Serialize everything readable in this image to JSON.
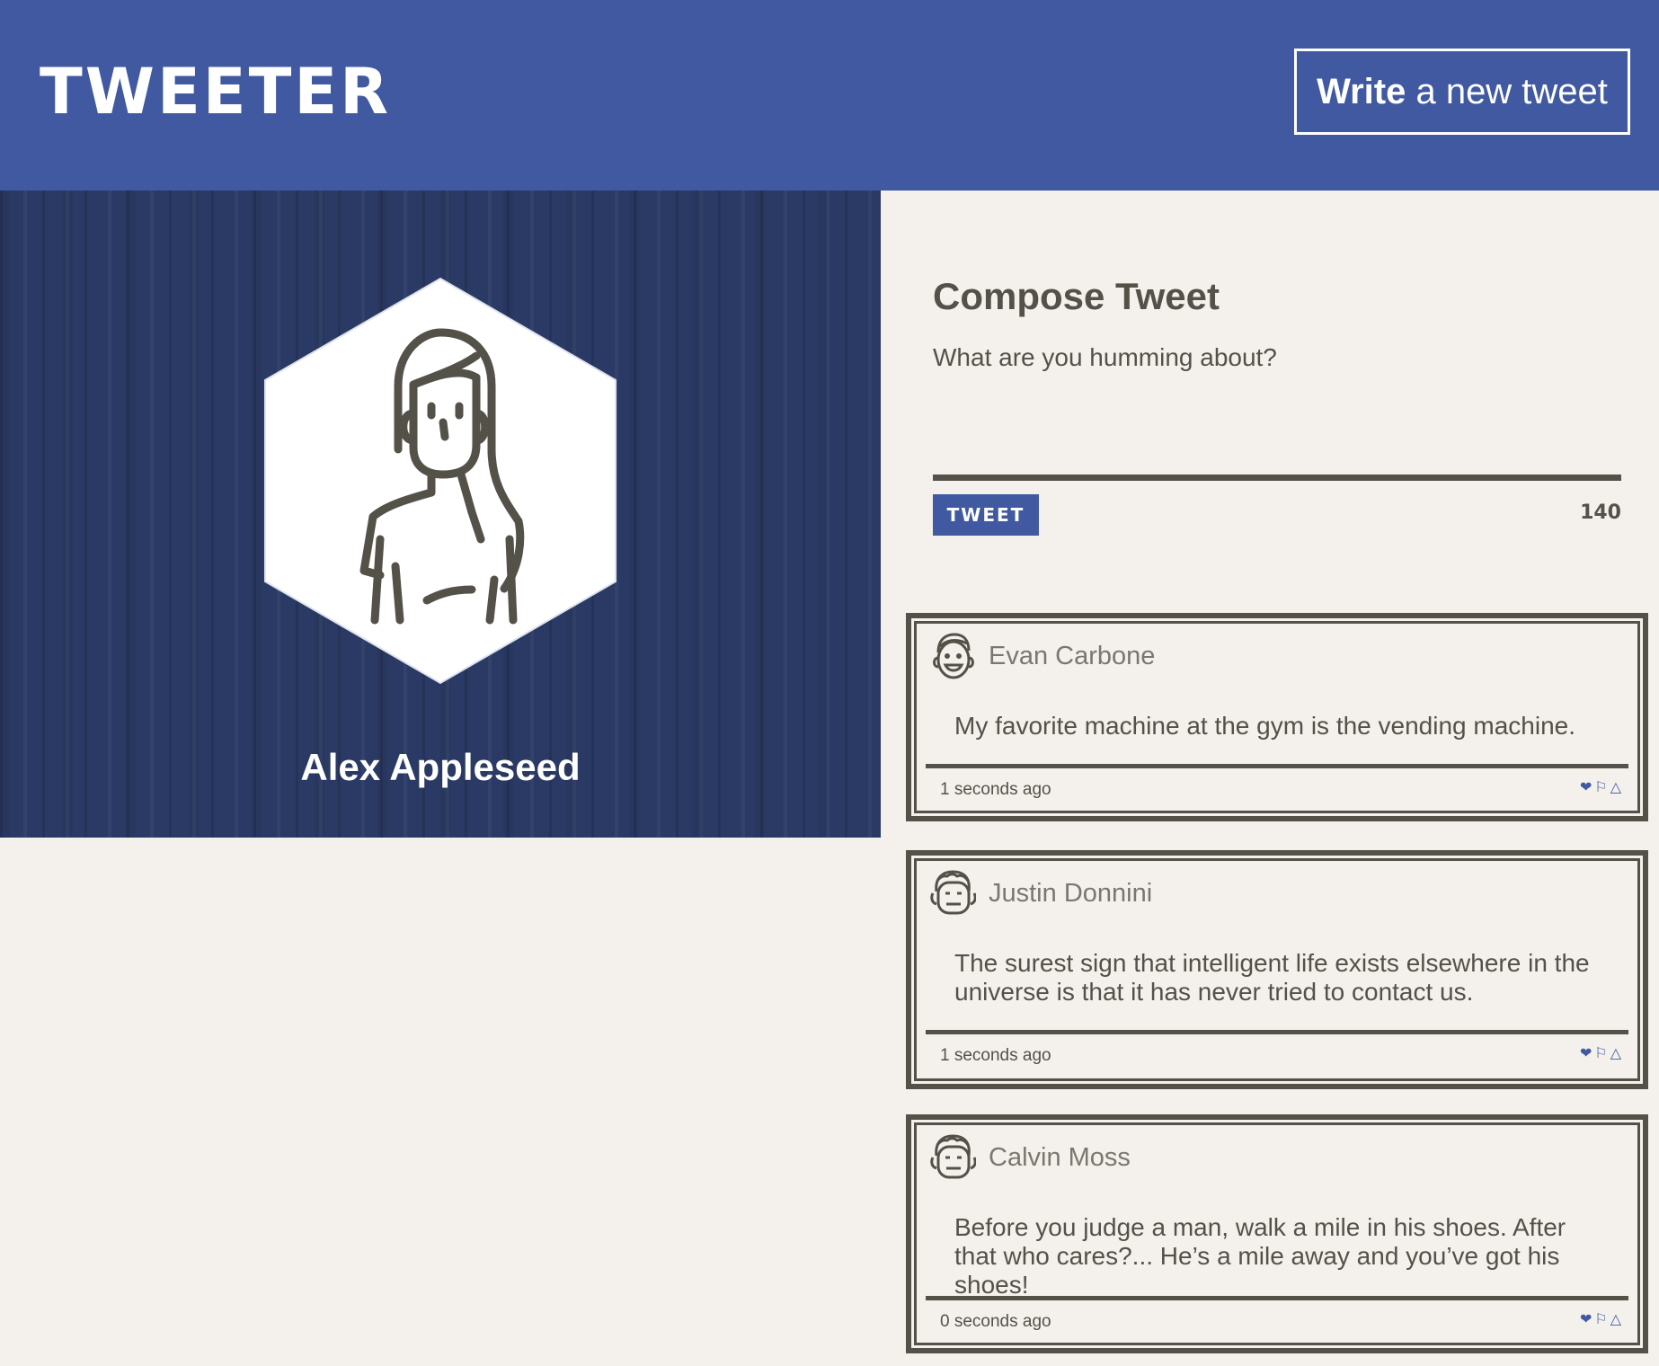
{
  "header": {
    "brand": "TWEETER",
    "write_bold": "Write",
    "write_rest": " a new tweet"
  },
  "profile": {
    "name": "Alex Appleseed",
    "avatar_icon": "woman-avatar-icon"
  },
  "compose": {
    "title": "Compose Tweet",
    "placeholder": "What are you humming about?",
    "button_label": "TWEET",
    "counter": "140"
  },
  "tweets": [
    {
      "author": "Evan Carbone",
      "text": "My favorite machine at the gym is the vending machine.",
      "time": "1 seconds ago"
    },
    {
      "author": "Justin Donnini",
      "text": "The surest sign that intelligent life exists elsewhere in the universe is that it has never tried to contact us.",
      "time": "1 seconds ago"
    },
    {
      "author": "Calvin Moss",
      "text": "Before you judge a man, walk a mile in his shoes. After that who cares?... He’s a mile away and you’ve got his shoes!",
      "time": "0 seconds ago"
    }
  ],
  "actions": {
    "like_icon": "❤",
    "flag_icon": "⚐",
    "retweet_icon": "△"
  },
  "colors": {
    "brand_blue": "#4059a0",
    "profile_bg": "#2b3a64",
    "page_bg": "#f4f1ec",
    "text_dark": "#545149"
  }
}
